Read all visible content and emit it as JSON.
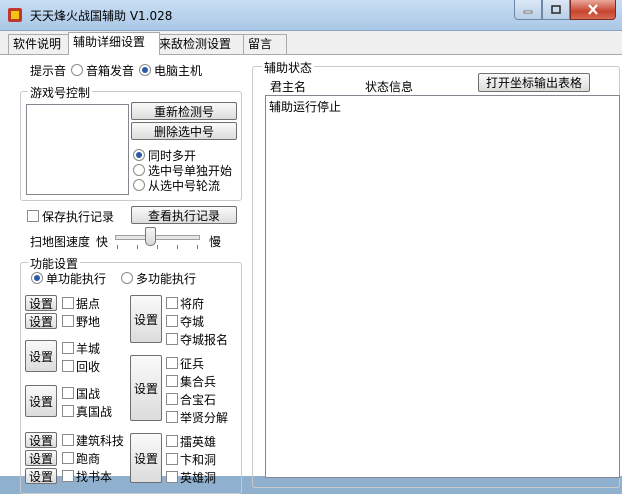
{
  "window": {
    "title": "天天烽火战国辅助 V1.028"
  },
  "tabs": [
    {
      "label": "软件说明"
    },
    {
      "label": "辅助详细设置"
    },
    {
      "label": "来敌检测设置"
    },
    {
      "label": "留言"
    }
  ],
  "alert": {
    "label": "提示音",
    "opt1": "音箱发音",
    "opt2": "电脑主机",
    "selected": "电脑主机"
  },
  "account": {
    "title": "游戏号控制",
    "recheck": "重新检测号",
    "delete": "删除选中号",
    "modes": [
      "同时多开",
      "选中号单独开始",
      "从选中号轮流"
    ],
    "selected_mode": "同时多开"
  },
  "log": {
    "save_label": "保存执行记录",
    "view_label": "查看执行记录"
  },
  "speed": {
    "label": "扫地图速度",
    "fast": "快",
    "slow": "慢",
    "level": 0.4
  },
  "features": {
    "title": "功能设置",
    "single": "单功能执行",
    "multi": "多功能执行",
    "selected": "单功能执行",
    "set_label": "设置",
    "left_groups": [
      [
        "据点",
        "野地"
      ],
      [
        "羊城",
        "回收"
      ],
      [
        "国战",
        "真国战"
      ],
      [
        "建筑科技",
        "跑商",
        "找书本"
      ]
    ],
    "right_groups": [
      [
        "将府",
        "夺城",
        "夺城报名"
      ],
      [
        "征兵",
        "集合兵",
        "合宝石",
        "举贤分解"
      ],
      [
        "擂英雄",
        "卞和洞",
        "英雄洞"
      ]
    ]
  },
  "status": {
    "title": "辅助状态",
    "col1": "君主名",
    "col2": "状态信息",
    "export": "打开坐标输出表格",
    "text": "辅助运行停止"
  }
}
